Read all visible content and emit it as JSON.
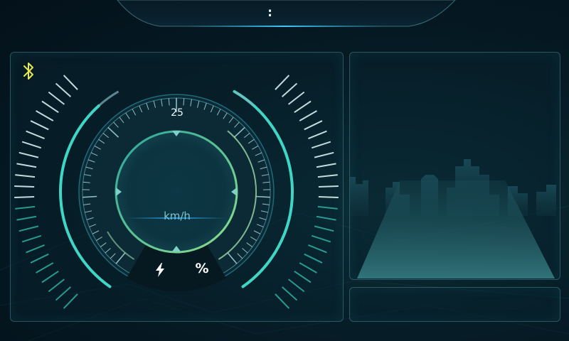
{
  "status_bar": {
    "time": ":"
  },
  "dashboard": {
    "max_speed_label": "25",
    "speed_unit": "km/h",
    "battery_label": "%"
  },
  "icons": {
    "bluetooth": "bluetooth-icon",
    "charge": "lightning-bolt-icon"
  },
  "colors": {
    "accent": "#3fd6c5",
    "bluetooth": "#e8e84a",
    "tick_light": "#d8f0f2",
    "tick_teal": "#2ea79a",
    "background": "#04141e"
  }
}
